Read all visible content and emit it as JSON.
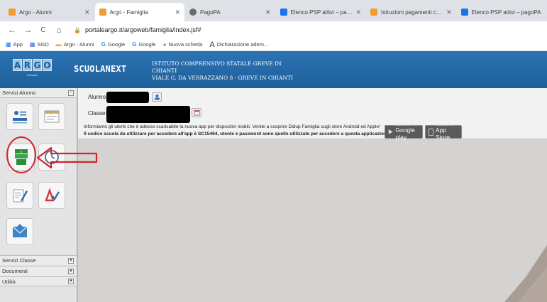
{
  "browser": {
    "tabs": [
      {
        "title": "Argo - Alunni",
        "favicon_color": "#f39c32",
        "active": false
      },
      {
        "title": "Argo - Famiglia",
        "favicon_color": "#f39c32",
        "active": true
      },
      {
        "title": "PagoPA",
        "favicon_color": "#6b6b6b",
        "active": false
      },
      {
        "title": "Elenco PSP attivi – pagoPA",
        "favicon_color": "#1a73e8",
        "active": false
      },
      {
        "title": "Istruzioni pagamenti con PagoPA",
        "favicon_color": "#f39c32",
        "active": false
      },
      {
        "title": "Elenco PSP attivi – pagoPA",
        "favicon_color": "#1a73e8",
        "active": false
      }
    ],
    "tab_close": "✕",
    "nav": {
      "back": "←",
      "forward": "→",
      "reload": "C",
      "home": "⌂"
    },
    "url": "portaleargo.it/argoweb/famiglia/index.jsf#",
    "bookmarks": [
      "App",
      "SGD",
      "Argo - Alunni",
      "Google",
      "Google",
      "Nuova scheda",
      "Dichiarazione adem..."
    ]
  },
  "header": {
    "logo_letters": [
      "A",
      "R",
      "G",
      "O"
    ],
    "logo_sub": "software",
    "brand": "SCUOLANEXT",
    "school_line1": "ISTITUTO COMPRENSIVO STATALE GREVE IN",
    "school_line2": "CHIANTI",
    "school_line3": "VIALE G. DA VERRAZZANO 8 - GREVE IN CHIANTI"
  },
  "sidebar": {
    "section_title": "Servizi Alunno",
    "footer_sections": [
      "Servizi Classe",
      "Documenti",
      "Utilità"
    ],
    "collapse_glyph": "−",
    "expand_glyph": "▾"
  },
  "main": {
    "alunno_label": "Alunno:",
    "classe_label": "Classe:",
    "message_line1": "Informiamo gli utenti che è adesso scaricabile la nuova app per dispositivi mobili. Venite a scoprire Didup Famiglia sugli store Android ed Apple!",
    "message_line2": "Il codice scuola da utilizzare per accedere all'app è SC15464, utente e password sono quelle utilizzate per accedere a questa applicazione.",
    "google_play_small": "ANDROID APP ON",
    "google_play_big": "Google play",
    "app_store_small": "Available on the",
    "app_store_big": "App Store"
  },
  "colors": {
    "header_blue": "#2d74b3",
    "annotation_red": "#d4232b"
  }
}
